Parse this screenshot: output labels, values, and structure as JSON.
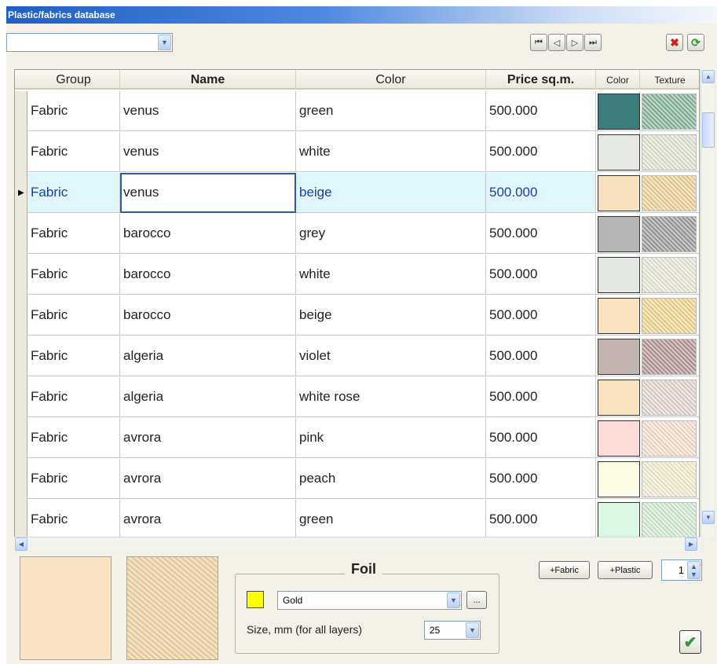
{
  "window": {
    "title": "Plastic/fabrics database"
  },
  "toolbar": {
    "filter_value": "",
    "nav": {
      "first": "⏮",
      "prev": "◁",
      "next": "▷",
      "last": "⏭"
    },
    "delete_icon": "✖",
    "refresh_icon": "⟳"
  },
  "grid": {
    "columns": [
      "Group",
      "Name",
      "Color",
      "Price sq.m.",
      "Color",
      "Texture"
    ],
    "selected_row": 2,
    "rows": [
      {
        "group": "Fabric",
        "name": "venus",
        "color": "green",
        "price": "500.000",
        "swatch": "#3e7c7b",
        "texture": "#8ab89b"
      },
      {
        "group": "Fabric",
        "name": "venus",
        "color": "white",
        "price": "500.000",
        "swatch": "#e6e9e3",
        "texture": "#e4e6d4"
      },
      {
        "group": "Fabric",
        "name": "venus",
        "color": "beige",
        "price": "500.000",
        "swatch": "#f7e2bf",
        "texture": "#efd49a"
      },
      {
        "group": "Fabric",
        "name": "barocco",
        "color": "grey",
        "price": "500.000",
        "swatch": "#b5b5b5",
        "texture": "#9e9e9e"
      },
      {
        "group": "Fabric",
        "name": "barocco",
        "color": "white",
        "price": "500.000",
        "swatch": "#e4e8e2",
        "texture": "#e9ead9"
      },
      {
        "group": "Fabric",
        "name": "barocco",
        "color": "beige",
        "price": "500.000",
        "swatch": "#f8e2bf",
        "texture": "#f2d892"
      },
      {
        "group": "Fabric",
        "name": "algeria",
        "color": "violet",
        "price": "500.000",
        "swatch": "#c2b5b1",
        "texture": "#b79a9a"
      },
      {
        "group": "Fabric",
        "name": "algeria",
        "color": "white rose",
        "price": "500.000",
        "swatch": "#f8e3c0",
        "texture": "#e5d8d0"
      },
      {
        "group": "Fabric",
        "name": "avrora",
        "color": "pink",
        "price": "500.000",
        "swatch": "#fbdcd8",
        "texture": "#f7e2cf"
      },
      {
        "group": "Fabric",
        "name": "avrora",
        "color": "peach",
        "price": "500.000",
        "swatch": "#fdfce6",
        "texture": "#f4f0d4"
      },
      {
        "group": "Fabric",
        "name": "avrora",
        "color": "green",
        "price": "500.000",
        "swatch": "#dcf8e5",
        "texture": "#d5ecd3"
      }
    ]
  },
  "preview": {
    "color": "#f8e3c2",
    "texture": "#f1d7a8"
  },
  "foil": {
    "title": "Foil",
    "color": "#ffff00",
    "selected": "Gold",
    "browse_label": "...",
    "size_label": "Size, mm (for all layers)",
    "size_value": "25"
  },
  "buttons": {
    "add_fabric": "+Fabric",
    "add_plastic": "+Plastic",
    "ok_icon": "✔"
  },
  "quantity": "1"
}
